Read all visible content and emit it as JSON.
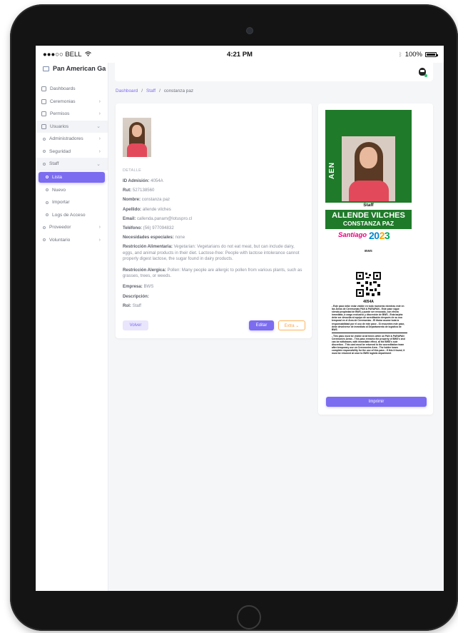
{
  "status_bar": {
    "carrier": "●●●○○ BELL",
    "time": "4:21 PM",
    "battery": "100%"
  },
  "sidebar": {
    "brand": "Pan American Ga",
    "items": [
      {
        "label": "Dashboards",
        "icon": "home-icon"
      },
      {
        "label": "Ceremonias",
        "icon": "ceremony-icon"
      },
      {
        "label": "Permisos",
        "icon": "permission-icon"
      },
      {
        "label": "Usuarios",
        "icon": "users-icon"
      },
      {
        "label": "Administradores"
      },
      {
        "label": "Seguridad"
      },
      {
        "label": "Staff"
      },
      {
        "label": "Lista"
      },
      {
        "label": "Nuevo"
      },
      {
        "label": "Importar"
      },
      {
        "label": "Logs de Acceso"
      },
      {
        "label": "Proveedor"
      },
      {
        "label": "Voluntario"
      }
    ]
  },
  "breadcrumb": {
    "home": "Dashboard",
    "section": "Staff",
    "current": "constanza paz"
  },
  "detail": {
    "section_label": "DETALLE",
    "id_label": "ID Admisión:",
    "id_value": "4054A",
    "rut_label": "Rut:",
    "rut_value": "527138560",
    "nombre_label": "Nombre:",
    "nombre_value": "constanza paz",
    "apellido_label": "Apellido:",
    "apellido_value": "allende vilches",
    "email_label": "Email:",
    "email_value": "callenda.panam@lotuspro.cl",
    "telefono_label": "Teléfono:",
    "telefono_value": "(56) 977094832",
    "necesidades_label": "Necesidades especiales:",
    "necesidades_value": "none",
    "alimentaria_label": "Restricción Alimentaria:",
    "alimentaria_value": "Vegetarian: Vegetarians do not eat meat, but can include dairy, eggs, and animal products in their diet. Lactose-free: People with lactose intolerance cannot properly digest lactose, the sugar found in dairy products.",
    "alergica_label": "Restricción Alergica:",
    "alergica_value": "Pollen: Many people are allergic to pollen from various plants, such as grasses, trees, or weeds.",
    "empresa_label": "Empresa:",
    "empresa_value": "BWS",
    "descripcion_label": "Descripción:",
    "descripcion_value": "",
    "rol_label": "Rol:",
    "rol_value": "Staff",
    "buttons": {
      "volver": "Volver",
      "editar": "Editar",
      "extra": "Extra ⌄"
    }
  },
  "badge": {
    "category": "AEN",
    "role": "Staff",
    "last_name": "ALLENDE VILCHES",
    "first_name": "CONSTANZA PAZ",
    "event_word": "Santiago",
    "event_year_1": "20",
    "event_year_2": "2",
    "event_year_3": "3",
    "company": "BWS",
    "id": "4054A",
    "rules_es": "- Este pase debe estar visible en todo momento mientras esté en las Áreas de Ceremonias PAN & PARAPAN - Este pase sigue siendo propiedad de BWS y puede ser revocado, con efecto inmediato, a cargo exclusivo y discreción de BWS - Esta tarjeta debe ser devuelta al equipo de acreditación después de su uso temporal en el Área de Ceremonias - El titular asume toda la responsabilidad por el uso de este pase - Si encuentra este pase, debe devolverse de inmediato al Departamento de logística de BWS",
    "rules_en": "- This pass must be visible at all times while on PAN & PARAPAN Ceremonies Areas - This pass remains the property of BWS's and can be withdrawn, with immediate effect, at the BWS's sole discretion - This card must be returned to the accreditation team after temporary use on Ceremonies Area - The holder bears complete responsibility for the use of this pass - If this it found, it must be returned at once to BWS logistic department",
    "print_button": "Imprimir"
  },
  "colors": {
    "accent": "#7b6cf0",
    "badge_green": "#1f7a2a",
    "extra_orange": "#ff9f43"
  }
}
